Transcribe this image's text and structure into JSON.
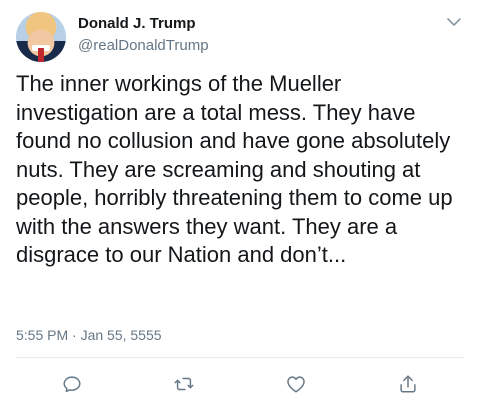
{
  "tweet": {
    "author": {
      "display_name": "Donald J. Trump",
      "handle": "@realDonaldTrump"
    },
    "text": "The inner workings of the Mueller investigation are a total mess. They have found no collusion and have gone absolutely nuts. They are screaming and shouting at people, horribly threatening them to come up with the answers they want. They are a disgrace to our Nation and don’t...",
    "timestamp": "5:55 PM · Jan 55, 5555"
  },
  "icons": {
    "more": "chevron-down-icon",
    "reply": "reply-icon",
    "retweet": "retweet-icon",
    "like": "heart-icon",
    "share": "share-icon"
  },
  "colors": {
    "text_primary": "#14171a",
    "text_secondary": "#657786",
    "icon": "#657786",
    "divider": "#e6ecf0"
  }
}
